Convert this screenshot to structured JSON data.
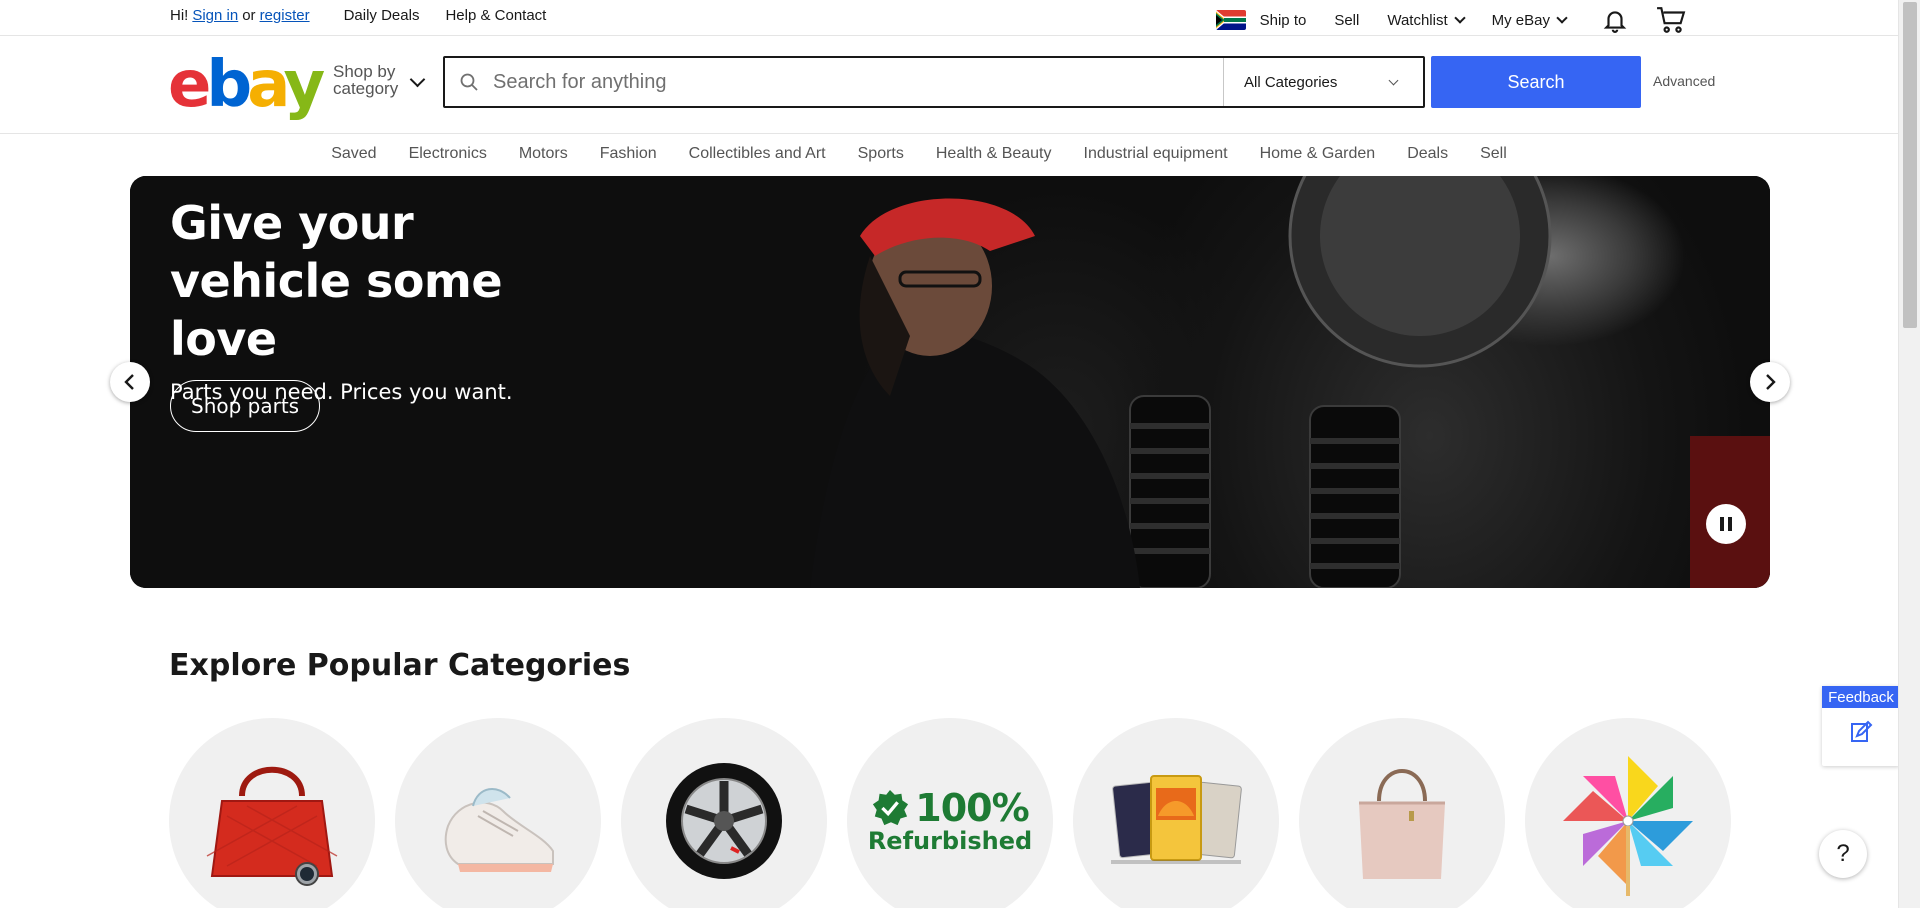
{
  "topbar": {
    "greeting": "Hi!",
    "sign_in": "Sign in",
    "or": "or",
    "register": "register",
    "daily_deals": "Daily Deals",
    "help_contact": "Help & Contact",
    "ship_to": "Ship to",
    "sell": "Sell",
    "watchlist": "Watchlist",
    "my_ebay": "My eBay"
  },
  "header": {
    "logo": {
      "e": "e",
      "b": "b",
      "a": "a",
      "y": "y"
    },
    "shop_by_line1": "Shop by",
    "shop_by_line2": "category",
    "search_placeholder": "Search for anything",
    "category_select": "All Categories",
    "search_button": "Search",
    "advanced": "Advanced"
  },
  "nav": {
    "items": [
      "Saved",
      "Electronics",
      "Motors",
      "Fashion",
      "Collectibles and Art",
      "Sports",
      "Health & Beauty",
      "Industrial equipment",
      "Home & Garden",
      "Deals",
      "Sell"
    ]
  },
  "hero": {
    "title": "Give your vehicle some love",
    "subtitle": "Parts you need. Prices you want.",
    "cta": "Shop parts"
  },
  "explore": {
    "title": "Explore Popular Categories",
    "refurbished_pct": "100%",
    "refurbished_label": "Refurbished"
  },
  "feedback": {
    "label": "Feedback"
  },
  "help": {
    "label": "?"
  },
  "colors": {
    "ebay_red": "#e53238",
    "ebay_blue": "#0064d2",
    "ebay_yellow": "#f5af02",
    "ebay_green": "#86b817",
    "search_blue": "#3665f3",
    "refurb_green": "#1e7b34"
  }
}
